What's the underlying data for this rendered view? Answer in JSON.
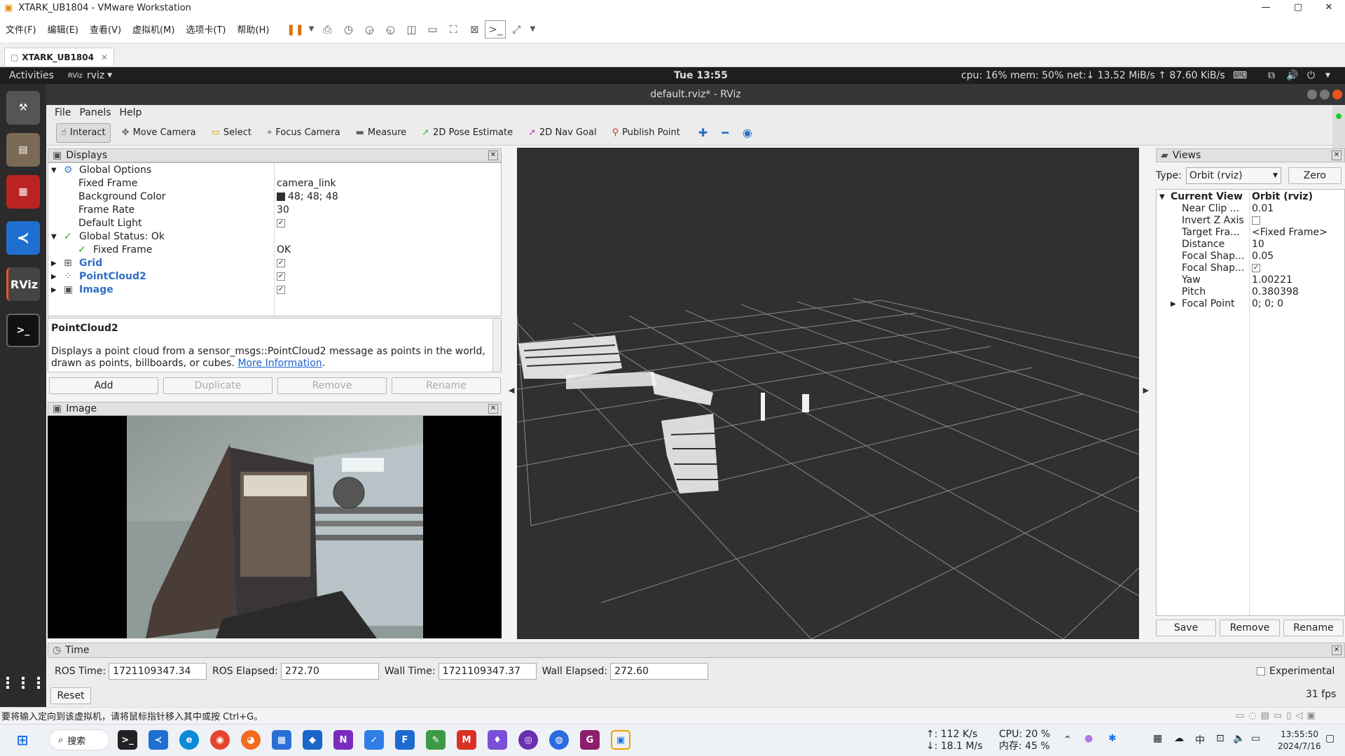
{
  "vmware": {
    "title": "XTARK_UB1804 - VMware Workstation",
    "menu": [
      "文件(F)",
      "编辑(E)",
      "查看(V)",
      "虚拟机(M)",
      "选项卡(T)",
      "帮助(H)"
    ],
    "tab": "XTARK_UB1804",
    "status": "要将输入定向到该虚拟机，请将鼠标指针移入其中或按 Ctrl+G。"
  },
  "topbar": {
    "activities": "Activities",
    "app": "rviz",
    "clock": "Tue 13:55",
    "sysmon": "cpu: 16% mem: 50% net:↓ 13.52 MiB/s ↑ 87.60 KiB/s"
  },
  "rviz": {
    "title": "default.rviz* - RViz",
    "menu": [
      "File",
      "Panels",
      "Help"
    ],
    "tools": [
      "Interact",
      "Move Camera",
      "Select",
      "Focus Camera",
      "Measure",
      "2D Pose Estimate",
      "2D Nav Goal",
      "Publish Point"
    ]
  },
  "displays": {
    "title": "Displays",
    "global_options": "Global Options",
    "fixed_frame_k": "Fixed Frame",
    "fixed_frame_v": "camera_link",
    "bg_color_k": "Background Color",
    "bg_color_v": "48; 48; 48",
    "frame_rate_k": "Frame Rate",
    "frame_rate_v": "30",
    "default_light_k": "Default Light",
    "global_status": "Global Status: Ok",
    "status_fixed_frame_k": "Fixed Frame",
    "status_fixed_frame_v": "OK",
    "grid": "Grid",
    "pointcloud2": "PointCloud2",
    "image": "Image",
    "desc_title": "PointCloud2",
    "desc_text": "Displays a point cloud from a sensor_msgs::PointCloud2 message as points in the world, drawn as points, billboards, or cubes.",
    "desc_link": "More Information",
    "buttons": [
      "Add",
      "Duplicate",
      "Remove",
      "Rename"
    ]
  },
  "image_panel": {
    "title": "Image"
  },
  "views": {
    "title": "Views",
    "type_label": "Type:",
    "type_value": "Orbit (rviz)",
    "zero": "Zero",
    "rows": [
      {
        "k": "Current View",
        "v": "Orbit (rviz)"
      },
      {
        "k": "Near Clip ...",
        "v": "0.01"
      },
      {
        "k": "Invert Z Axis",
        "v": ""
      },
      {
        "k": "Target Fra...",
        "v": "<Fixed Frame>"
      },
      {
        "k": "Distance",
        "v": "10"
      },
      {
        "k": "Focal Shap...",
        "v": "0.05"
      },
      {
        "k": "Focal Shap...",
        "v": ""
      },
      {
        "k": "Yaw",
        "v": "1.00221"
      },
      {
        "k": "Pitch",
        "v": "0.380398"
      },
      {
        "k": "Focal Point",
        "v": "0; 0; 0"
      }
    ],
    "buttons": [
      "Save",
      "Remove",
      "Rename"
    ]
  },
  "time": {
    "title": "Time",
    "ros_time_label": "ROS Time:",
    "ros_time": "1721109347.34",
    "ros_elapsed_label": "ROS Elapsed:",
    "ros_elapsed": "272.70",
    "wall_time_label": "Wall Time:",
    "wall_time": "1721109347.37",
    "wall_elapsed_label": "Wall Elapsed:",
    "wall_elapsed": "272.60",
    "experimental": "Experimental",
    "reset": "Reset",
    "fps": "31 fps"
  },
  "taskbar": {
    "search": "搜索",
    "net_up": "↑: 112 K/s",
    "net_down": "↓: 18.1 M/s",
    "cpu": "CPU: 20 %",
    "mem": "内存: 45 %",
    "ime": "中",
    "time": "13:55:50",
    "date": "2024/7/16"
  }
}
